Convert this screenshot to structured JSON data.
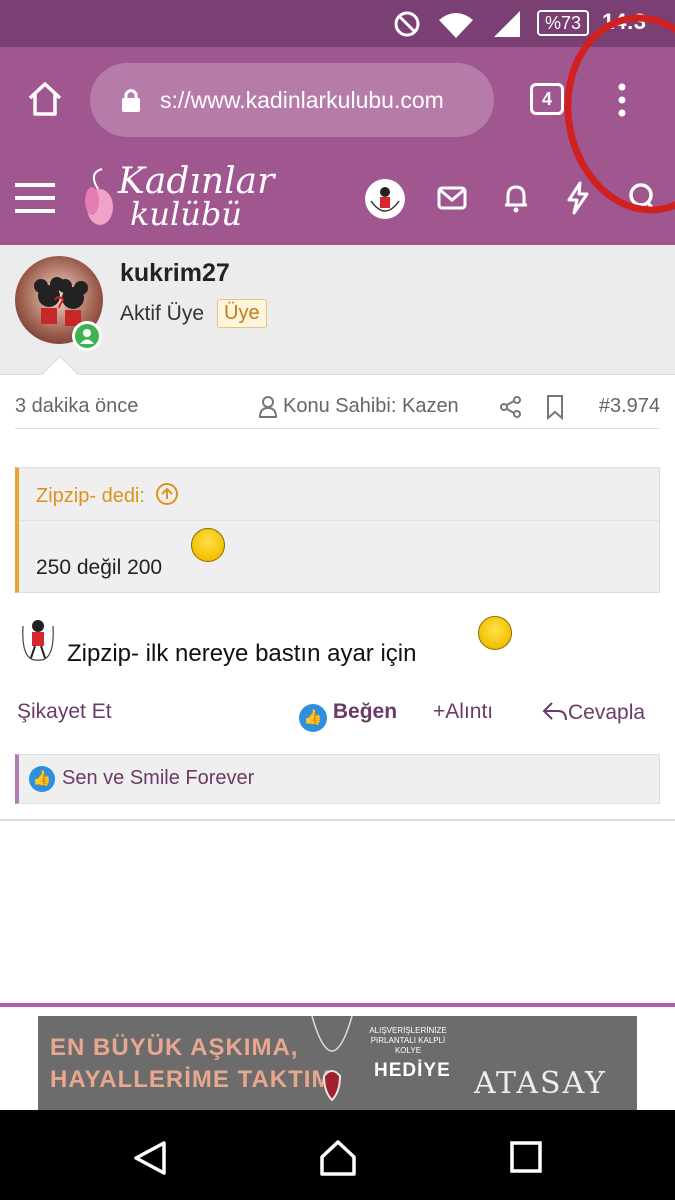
{
  "status_bar": {
    "battery": "%73",
    "time": "14:3"
  },
  "browser": {
    "url": "s://www.kadinlarkulubu.com",
    "tab_count": "4"
  },
  "site": {
    "logo_line1": "Kadınlar",
    "logo_line2": "kulübü"
  },
  "post": {
    "username": "kukrim27",
    "user_title": "Aktif Üye",
    "badge": "Üye",
    "time": "3 dakika önce",
    "owner": "Konu Sahibi: Kazen",
    "number": "#3.974",
    "quote_author": "Zipzip- dedi:",
    "quote_text": "250 değil 200",
    "message": "Zipzip- ilk nereye bastın ayar için",
    "actions": {
      "report": "Şikayet Et",
      "like": "Beğen",
      "quote": "Alıntı",
      "reply": "Cevapla"
    },
    "likes": "Sen ve Smile Forever"
  },
  "ad": {
    "headline_line1": "EN BÜYÜK AŞKIMA,",
    "headline_line2": "HAYALLERİME TAKTIM",
    "small_text": "ALIŞVERİŞLERİNİZE PIRLANTALI KALPLİ KOLYE",
    "gift": "HEDİYE",
    "brand": "ATASAY"
  },
  "colors": {
    "status_bar": "#7a3f73",
    "brand_purple": "#a0568f",
    "quote_accent": "#e8a531",
    "link_purple": "#6a3b66",
    "like_blue": "#2d8fe0",
    "annotation_red": "#d12020"
  }
}
